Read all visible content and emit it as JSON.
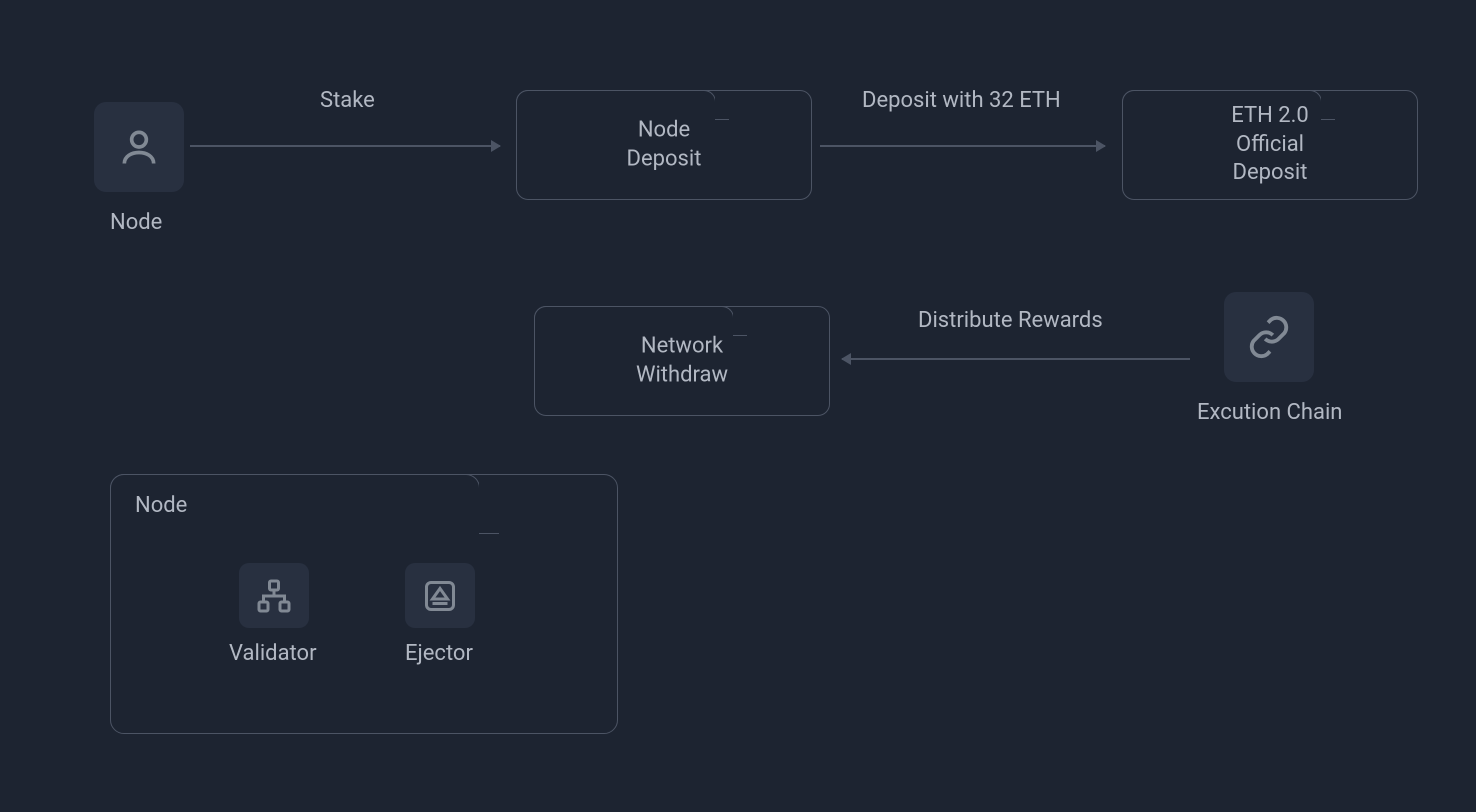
{
  "nodes": {
    "node_actor": {
      "label": "Node"
    },
    "node_deposit": {
      "label": "Node\nDeposit"
    },
    "eth_deposit": {
      "label": "ETH 2.0\nOfficial\nDeposit"
    },
    "network_withdraw": {
      "label": "Network\nWithdraw"
    },
    "execution_chain": {
      "label": "Excution Chain"
    },
    "node_group": {
      "label": "Node",
      "validator": {
        "label": "Validator"
      },
      "ejector": {
        "label": "Ejector"
      }
    }
  },
  "edges": {
    "stake": {
      "label": "Stake"
    },
    "deposit_32": {
      "label": "Deposit with 32 ETH"
    },
    "distribute": {
      "label": "Distribute Rewards"
    }
  }
}
